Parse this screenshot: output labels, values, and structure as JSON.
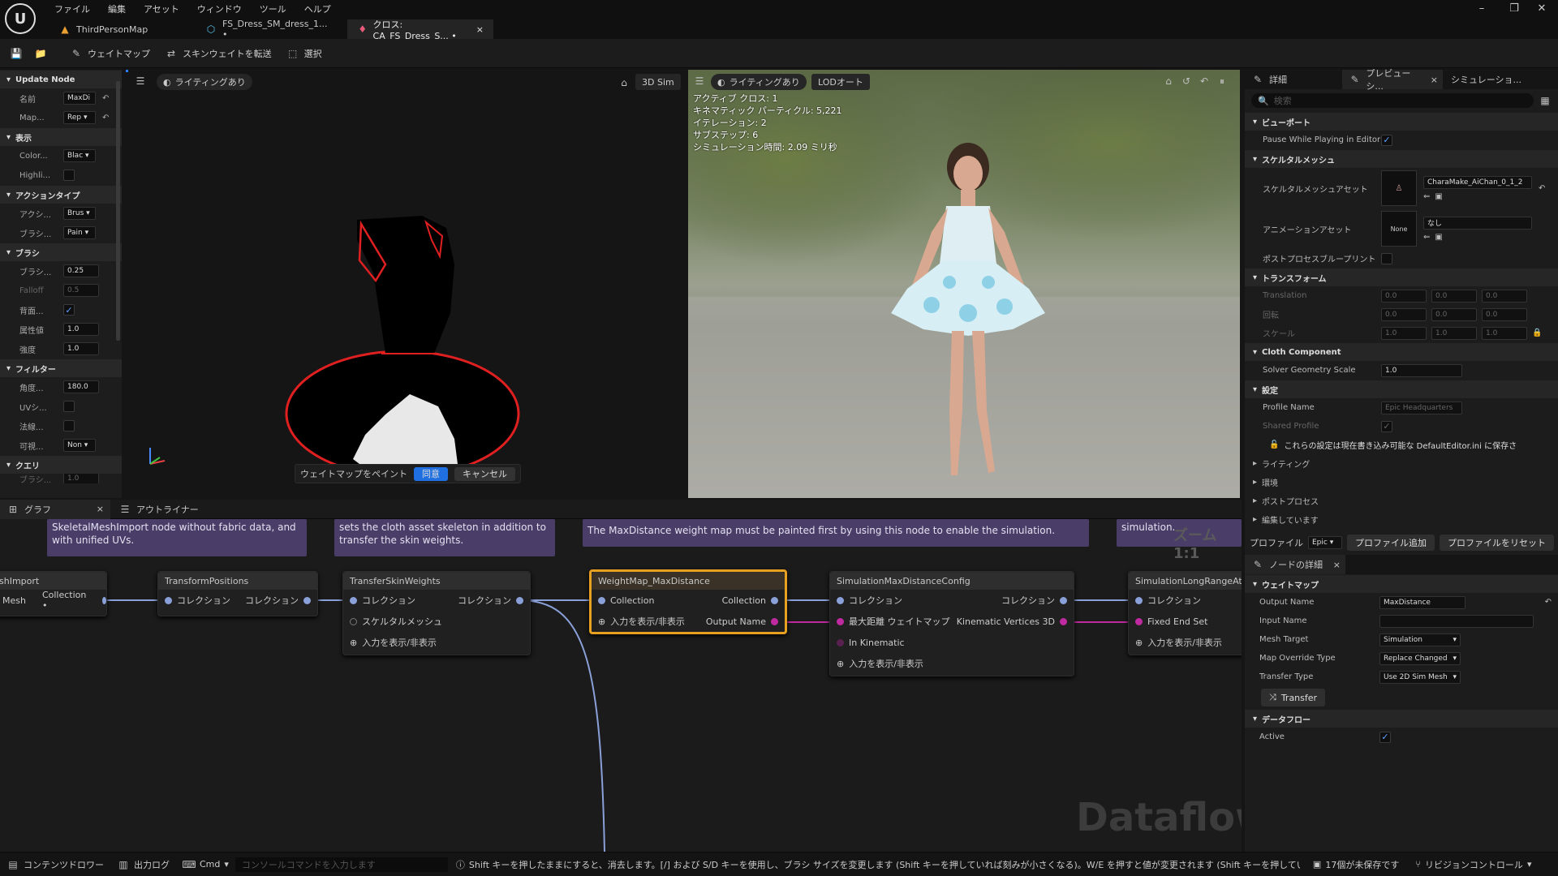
{
  "title_bar": {
    "menu": [
      "ファイル",
      "編集",
      "アセット",
      "ウィンドウ",
      "ツール",
      "ヘルプ"
    ],
    "tabs": [
      {
        "label": "ThirdPersonMap"
      },
      {
        "label": "FS_Dress_SM_dress_1... •"
      },
      {
        "label": "クロス: CA_FS_Dress_S... •"
      }
    ],
    "close_tab": "×"
  },
  "toolbar": {
    "weightmap": "ウェイトマップ",
    "transfer_skin": "スキンウェイトを転送",
    "select": "選択"
  },
  "left_panel": {
    "sections": [
      {
        "title": "Update Node",
        "rows": [
          {
            "label": "名前",
            "value": "MaxDi"
          },
          {
            "label": "Map...",
            "value": "Rep ▾"
          }
        ]
      },
      {
        "title": "表示",
        "rows": [
          {
            "label": "Color...",
            "value": "Blac ▾"
          },
          {
            "label": "Highli...",
            "value": ""
          }
        ]
      },
      {
        "title": "アクションタイプ",
        "rows": [
          {
            "label": "アクシ...",
            "value": "Brus ▾"
          },
          {
            "label": "ブラシ...",
            "value": "Pain ▾"
          }
        ]
      },
      {
        "title": "ブラシ",
        "rows": [
          {
            "label": "ブラシ...",
            "value": "0.25"
          },
          {
            "label": "Falloff",
            "value": "0.5"
          },
          {
            "label": "背面...",
            "value": "✓"
          },
          {
            "label": "属性値",
            "value": "1.0"
          },
          {
            "label": "強度",
            "value": "1.0"
          }
        ]
      },
      {
        "title": "フィルター",
        "rows": [
          {
            "label": "角度...",
            "value": "180.0"
          },
          {
            "label": "UVシ...",
            "value": ""
          },
          {
            "label": "法線...",
            "value": ""
          },
          {
            "label": "可視...",
            "value": "Non ▾"
          }
        ]
      },
      {
        "title": "クエリ",
        "rows": [
          {
            "label": "ブラシ...",
            "value": "1.0"
          }
        ]
      }
    ]
  },
  "viewport_left": {
    "lighting": "ライティングあり",
    "sim3d": "3D Sim",
    "paint_label": "ウェイトマップをペイント",
    "accept": "同意",
    "cancel": "キャンセル"
  },
  "viewport_right": {
    "lighting": "ライティングあり",
    "lod": "LODオート",
    "stats": [
      "アクティブ クロス: 1",
      "キネマティック パーティクル: 5,221",
      "イテレーション: 2",
      "サブステップ: 6",
      "シミュレーション時間: 2.09 ミリ秒"
    ]
  },
  "graph": {
    "tabs": [
      "グラフ",
      "アウトライナー"
    ],
    "comments": [
      "SkeletalMeshImport node without fabric data, and with unified UVs.",
      "sets the cloth asset skeleton in addition to transfer the skin weights.",
      "The MaxDistance weight map must be painted first by using this node to enable the simulation.",
      "simulation."
    ],
    "zoom": "ズーム 1:1",
    "watermark": "Dataflow",
    "nodes": {
      "import": {
        "title": "shImport",
        "pin_mesh": "Mesh",
        "pin_collection": "Collection •"
      },
      "transform": {
        "title": "TransformPositions",
        "in": "コレクション",
        "out": "コレクション"
      },
      "transfer": {
        "title": "TransferSkinWeights",
        "in": "コレクション",
        "out": "コレクション",
        "in2": "スケルタルメッシュ",
        "toggle": "入力を表示/非表示"
      },
      "weightmap": {
        "title": "WeightMap_MaxDistance",
        "in": "Collection",
        "out": "Collection",
        "toggle": "入力を表示/非表示",
        "out2": "Output Name"
      },
      "simconfig": {
        "title": "SimulationMaxDistanceConfig",
        "in": "コレクション",
        "out": "コレクション",
        "in2": "最大距離 ウェイトマップ",
        "out2": "Kinematic Vertices 3D",
        "in3": "In Kinematic",
        "toggle": "入力を表示/非表示"
      },
      "longrange": {
        "title": "SimulationLongRangeAtt",
        "in": "コレクション",
        "in2": "Fixed End Set",
        "toggle": "入力を表示/非表示"
      }
    }
  },
  "right_panel": {
    "tabs": [
      "詳細",
      "プレビューシ...",
      "シミュレーショ..."
    ],
    "search_placeholder": "検索",
    "viewport_section": "ビューポート",
    "pause_label": "Pause While Playing in Editor",
    "skeletal_section": "スケルタルメッシュ",
    "skeletal_asset_label": "スケルタルメッシュアセット",
    "skeletal_asset_value": "CharaMake_AiChan_0_1_2",
    "anim_label": "アニメーションアセット",
    "anim_value": "なし",
    "none_thumb": "None",
    "postprocess_label": "ポストプロセスブループリント",
    "transform_section": "トランスフォーム",
    "translation": "Translation",
    "rotation": "回転",
    "scale": "スケール",
    "zero": "0.0",
    "one": "1.0",
    "cloth_section": "Cloth Component",
    "solver_label": "Solver Geometry Scale",
    "solver_value": "1.0",
    "settings_section": "設定",
    "profile_name_label": "Profile Name",
    "profile_name_value": "Epic Headquarters",
    "shared_profile_label": "Shared Profile",
    "notice": "これらの設定は現在書き込み可能な DefaultEditor.ini に保存さ",
    "collapsed": [
      "ライティング",
      "環境",
      "ポストプロセス",
      "編集しています"
    ],
    "profile_label": "プロファイル",
    "profile_value": "Epic",
    "add_profile": "プロファイル追加",
    "reset_profile": "プロファイルをリセット",
    "node_details_tab": "ノードの詳細",
    "weightmap_section": "ウェイトマップ",
    "output_name_label": "Output Name",
    "output_name_value": "MaxDistance",
    "input_name_label": "Input Name",
    "mesh_target_label": "Mesh Target",
    "mesh_target_value": "Simulation",
    "override_label": "Map Override Type",
    "override_value": "Replace Changed",
    "transfer_type_label": "Transfer Type",
    "transfer_type_value": "Use 2D Sim Mesh",
    "transfer_button": "Transfer",
    "dataflow_section": "データフロー",
    "active_label": "Active"
  },
  "status_bar": {
    "content_drawer": "コンテンツドロワー",
    "output_log": "出力ログ",
    "cmd": "Cmd",
    "console_placeholder": "コンソールコマンドを入力します",
    "hint": "Shift キーを押したままにすると、消去します。[/] および S/D キーを使用し、ブラシ サイズを変更します (Shift キーを押していれば刻みが小さくなる)。W/E を押すと値が変更されます (Shift キーを押していれば",
    "unsaved": "17個が未保存です",
    "revision": "リビジョンコントロール"
  },
  "colors": {
    "accent_blue": "#1f6fe0",
    "node_selected": "#e8a020",
    "comment": "#4a3e68",
    "outline_red": "#e02020"
  }
}
